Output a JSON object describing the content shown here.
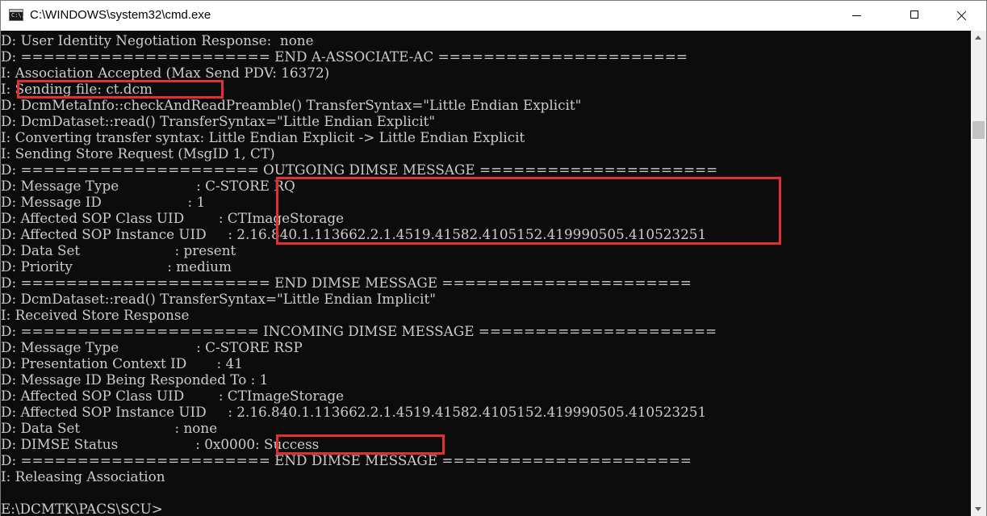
{
  "window": {
    "title": "C:\\WINDOWS\\system32\\cmd.exe",
    "icon": "cmd-console-icon",
    "icon_text": "C:\\.",
    "controls": [
      "minimize-icon",
      "maximize-icon",
      "close-icon"
    ]
  },
  "console": {
    "background": "#0c0c0c",
    "text_color": "#cccccc",
    "highlight_color": "#e0312f",
    "lines": [
      "D: User Identity Negotiation Response:  none",
      "D: ====================== END A-ASSOCIATE-AC ======================",
      "I: Association Accepted (Max Send PDV: 16372)",
      "I: Sending file: ct.dcm",
      "D: DcmMetaInfo::checkAndReadPreamble() TransferSyntax=\"Little Endian Explicit\"",
      "D: DcmDataset::read() TransferSyntax=\"Little Endian Explicit\"",
      "I: Converting transfer syntax: Little Endian Explicit -> Little Endian Explicit",
      "I: Sending Store Request (MsgID 1, CT)",
      "D: ===================== OUTGOING DIMSE MESSAGE =====================",
      "D: Message Type                  : C-STORE RQ",
      "D: Message ID                    : 1",
      "D: Affected SOP Class UID        : CTImageStorage",
      "D: Affected SOP Instance UID     : 2.16.840.1.113662.2.1.4519.41582.4105152.419990505.410523251",
      "D: Data Set                      : present",
      "D: Priority                      : medium",
      "D: ====================== END DIMSE MESSAGE ======================",
      "D: DcmDataset::read() TransferSyntax=\"Little Endian Implicit\"",
      "I: Received Store Response",
      "D: ===================== INCOMING DIMSE MESSAGE =====================",
      "D: Message Type                  : C-STORE RSP",
      "D: Presentation Context ID       : 41",
      "D: Message ID Being Responded To : 1",
      "D: Affected SOP Class UID        : CTImageStorage",
      "D: Affected SOP Instance UID     : 2.16.840.1.113662.2.1.4519.41582.4105152.419990505.410523251",
      "D: Data Set                      : none",
      "D: DIMSE Status                  : 0x0000: Success",
      "D: ====================== END DIMSE MESSAGE ======================",
      "I: Releasing Association",
      "",
      "E:\\DCMTK\\PACS\\SCU>"
    ]
  },
  "highlights": [
    "sending-file-highlight",
    "store-request-fields-highlight",
    "dimse-status-highlight"
  ],
  "scrollbar": {
    "icons": [
      "scroll-up-icon",
      "scroll-down-icon"
    ]
  }
}
